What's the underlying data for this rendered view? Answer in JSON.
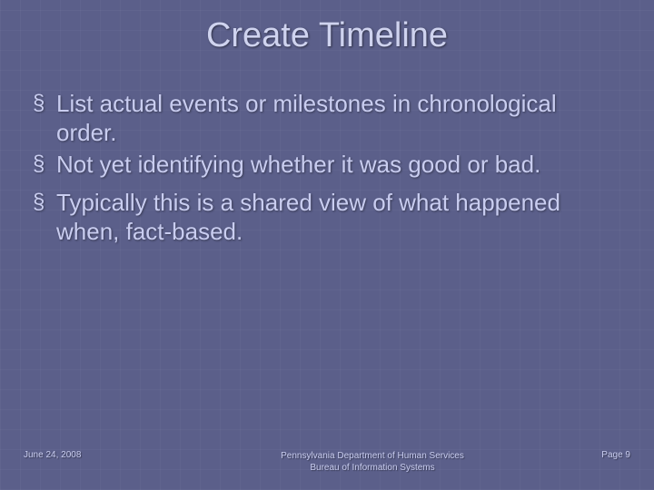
{
  "title": "Create Timeline",
  "bullets": [
    "List actual events or milestones in chronological order.",
    "Not yet identifying whether it was good or bad.",
    "Typically this is a shared view of what happened when, fact-based."
  ],
  "footer": {
    "date": "June 24, 2008",
    "org_line1": "Pennsylvania Department of Human Services",
    "org_line2": "Bureau of Information Systems",
    "page": "Page 9"
  }
}
